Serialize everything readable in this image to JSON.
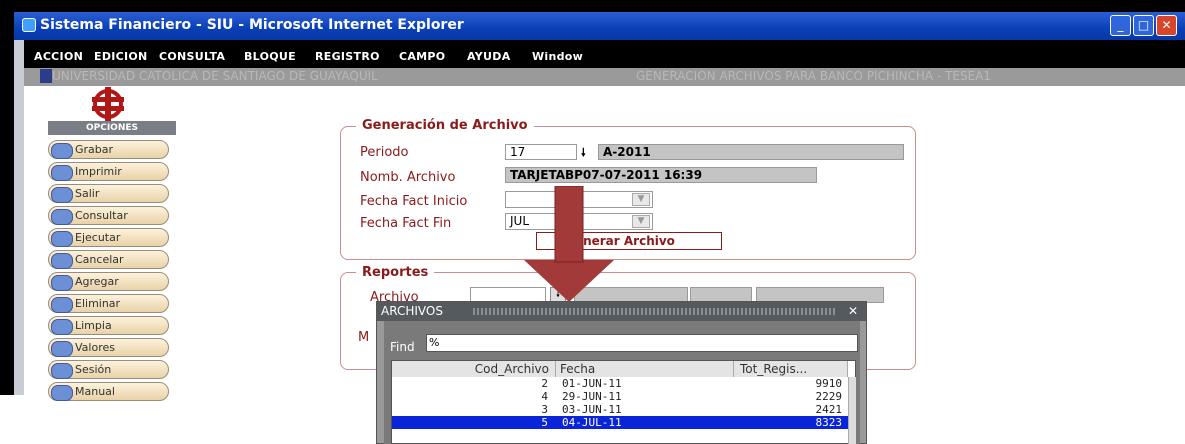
{
  "window": {
    "title": "Sistema Financiero - SIU - Microsoft Internet Explorer",
    "buttons": {
      "minimize": "_",
      "maximize": "□",
      "close": "✕"
    }
  },
  "menu": [
    "ACCION",
    "EDICION",
    "CONSULTA",
    "BLOQUE",
    "REGISTRO",
    "CAMPO",
    "AYUDA",
    "Window"
  ],
  "header": {
    "left": "UNIVERSIDAD CATOLICA DE SANTIAGO DE GUAYAQUIL",
    "right": "GENERACION ARCHIVOS PARA BANCO PICHINCHA - TESEA1"
  },
  "options": {
    "title": "OPCIONES",
    "items": [
      "Grabar",
      "Imprimir",
      "Salir",
      "Consultar",
      "Ejecutar",
      "Cancelar",
      "Agregar",
      "Eliminar",
      "Limpia",
      "Valores",
      "Sesión",
      "Manual"
    ]
  },
  "generacion": {
    "title": "Generación de Archivo",
    "periodo_label": "Periodo",
    "periodo_value": "17",
    "periodo_desc": "A-2011",
    "nomb_label": "Nomb. Archivo",
    "nomb_value": "TARJETABP07-07-2011 16:39",
    "fecha_inicio_label": "Fecha Fact Inicio",
    "fecha_inicio_value": "",
    "fecha_fin_label": "Fecha Fact Fin",
    "fecha_fin_value": "JUL",
    "generar_button": "nerar Archivo"
  },
  "reportes": {
    "title": "Reportes",
    "archivo_label": "Archivo",
    "other_label": "M"
  },
  "popup": {
    "title": "ARCHIVOS",
    "close": "✕",
    "find_label": "Find",
    "find_value": "%",
    "columns": [
      "Cod_Archivo",
      "Fecha",
      "Tot_Regis..."
    ],
    "rows": [
      {
        "cod": "2",
        "fecha": "01-JUN-11",
        "tot": "9910"
      },
      {
        "cod": "4",
        "fecha": "29-JUN-11",
        "tot": "2229"
      },
      {
        "cod": "3",
        "fecha": "03-JUN-11",
        "tot": "2421"
      },
      {
        "cod": "5",
        "fecha": "04-JUL-11",
        "tot": "8323"
      }
    ],
    "selected_row": 3
  },
  "colors": {
    "accent": "#8b1a1a",
    "selection": "#0a24d8",
    "titlebar": "#0a3fb5"
  }
}
